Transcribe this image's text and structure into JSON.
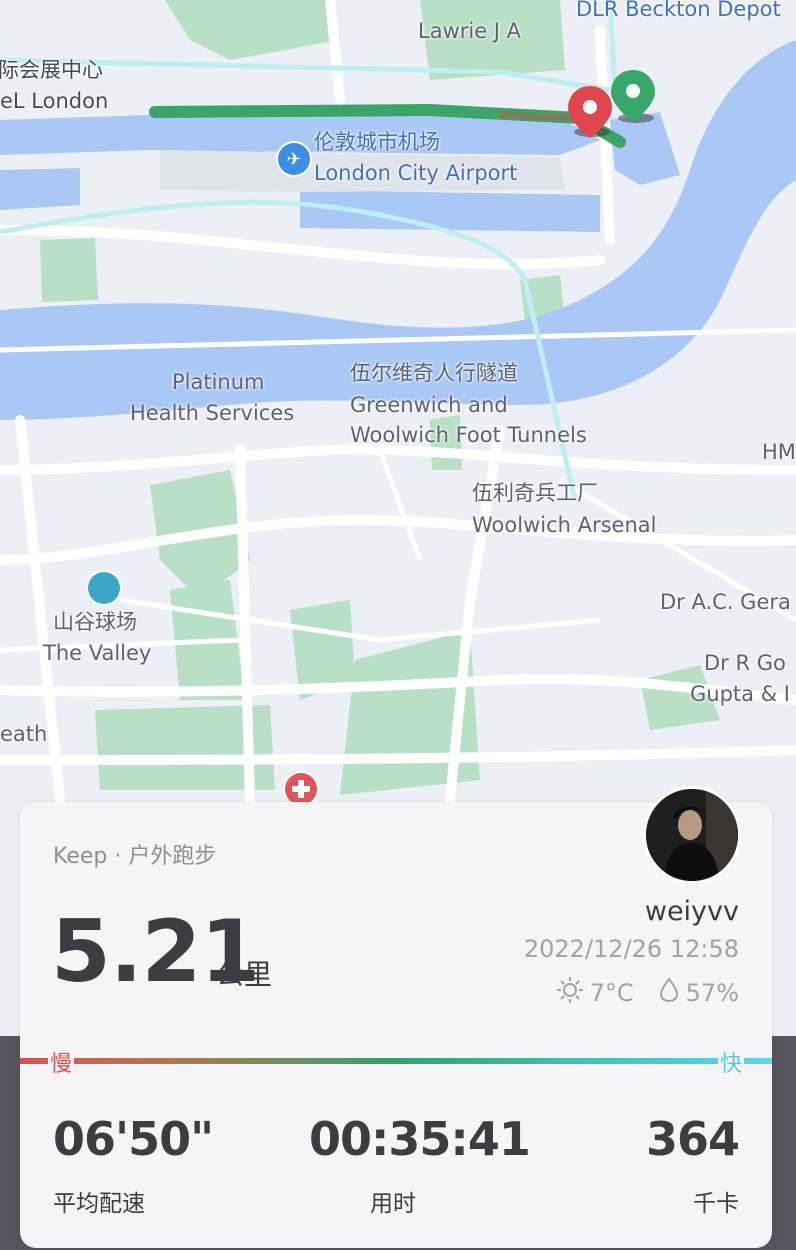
{
  "map": {
    "labels": {
      "lawrie": "Lawrie J A",
      "beckton": "DLR Beckton Depot",
      "excel_cn": "际会展中心",
      "excel_en": "eL London",
      "airport_cn": "伦敦城市机场",
      "airport_en": "London City Airport",
      "platinum_1": "Platinum",
      "platinum_2": "Health Services",
      "tunnel_cn": "伍尔维奇人行隧道",
      "tunnel_en1": "Greenwich and",
      "tunnel_en2": "Woolwich Foot Tunnels",
      "hm": "HM",
      "arsenal_cn": "伍利奇兵工厂",
      "arsenal_en": "Woolwich Arsenal",
      "valley_cn": "山谷球场",
      "valley_en": "The Valley",
      "dr_ac": "Dr A.C. Gera",
      "dr_r1": "Dr R Go",
      "dr_r2": "Gupta & I",
      "heath": "eath"
    },
    "icons": [
      "airport-icon",
      "stadium-icon",
      "hospital-icon",
      "start-pin-icon",
      "end-pin-icon"
    ],
    "colors": {
      "water": "#a9c8f5",
      "park": "#b7e0c5",
      "route": "#3aa566",
      "rail": "#bdeef0",
      "pin_red": "#e0474c",
      "pin_green": "#36a86a"
    }
  },
  "card": {
    "source": "Keep · 户外跑步",
    "distance": "5.21",
    "distance_unit": "公里",
    "username": "weiyvv",
    "datetime": "2022/12/26 12:58",
    "temperature": "7°C",
    "humidity": "57%",
    "weather_icons": [
      "sun-icon",
      "droplet-icon"
    ],
    "pace_slow": "慢",
    "pace_fast": "快",
    "stats": [
      {
        "value": "06'50\"",
        "label": "平均配速"
      },
      {
        "value": "00:35:41",
        "label": "用时"
      },
      {
        "value": "364",
        "label": "千卡"
      }
    ]
  }
}
